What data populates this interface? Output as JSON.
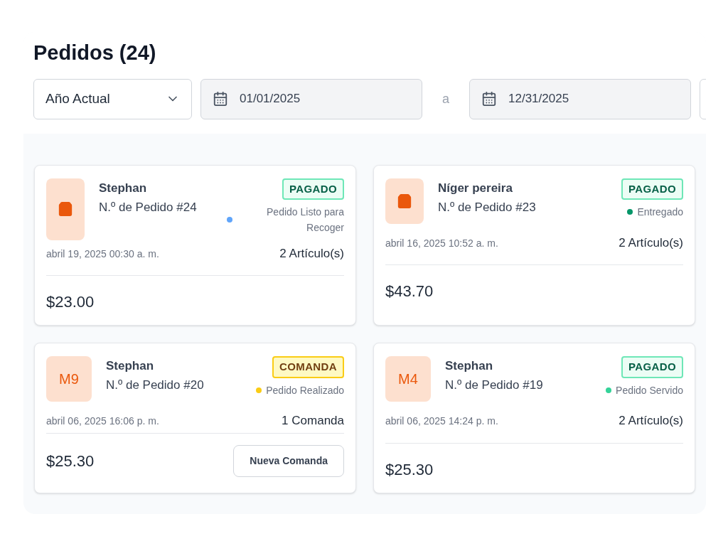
{
  "title": "Pedidos (24)",
  "filters": {
    "period": "Año Actual",
    "date_from": "01/01/2025",
    "separator": "a",
    "date_to": "12/31/2025"
  },
  "orders": [
    {
      "avatar": {
        "kind": "bag"
      },
      "customer": "Stephan",
      "number": "N.º de Pedido #24",
      "badge": {
        "kind": "paid",
        "label": "PAGADO"
      },
      "status": {
        "label": "Pedido Listo para Recoger",
        "color": "#60a5fa"
      },
      "date": "abril 19, 2025 00:30 a. m.",
      "count": "2 Artículo(s)",
      "total": "$23.00"
    },
    {
      "avatar": {
        "kind": "bag"
      },
      "customer": "Níger pereira",
      "number": "N.º de Pedido #23",
      "badge": {
        "kind": "paid",
        "label": "PAGADO"
      },
      "status": {
        "label": "Entregado",
        "color": "#059669"
      },
      "date": "abril 16, 2025 10:52 a. m.",
      "count": "2 Artículo(s)",
      "total": "$43.70"
    },
    {
      "avatar": {
        "kind": "table",
        "label": "M9"
      },
      "customer": "Stephan",
      "number": "N.º de Pedido #20",
      "badge": {
        "kind": "comanda",
        "label": "COMANDA"
      },
      "status": {
        "label": "Pedido Realizado",
        "color": "#facc15"
      },
      "date": "abril 06, 2025 16:06 p. m.",
      "count": "1 Comanda",
      "total": "$25.30",
      "button": "Nueva Comanda"
    },
    {
      "avatar": {
        "kind": "table",
        "label": "M4"
      },
      "customer": "Stephan",
      "number": "N.º de Pedido #19",
      "badge": {
        "kind": "paid",
        "label": "PAGADO"
      },
      "status": {
        "label": "Pedido Servido",
        "color": "#34d399"
      },
      "date": "abril 06, 2025 14:24 p. m.",
      "count": "2 Artículo(s)",
      "total": "$25.30"
    }
  ]
}
